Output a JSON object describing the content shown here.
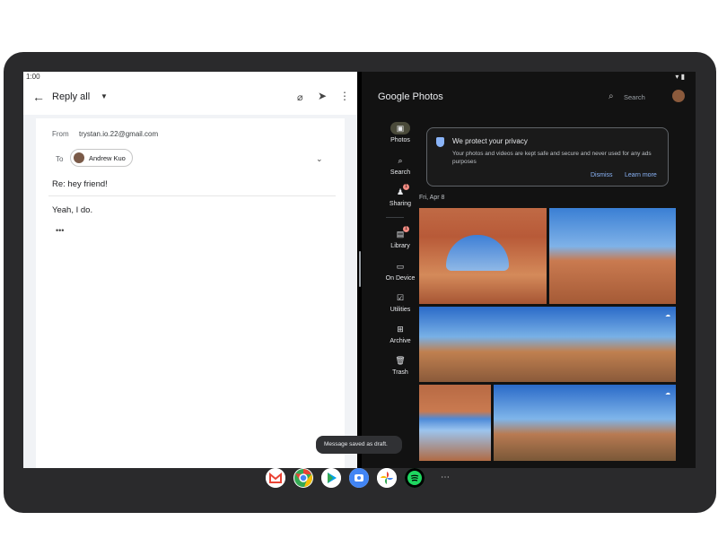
{
  "status_bar": {
    "time": "1:00",
    "icons": "▾ ▮"
  },
  "gmail": {
    "back_icon": "arrow-left-icon",
    "title": "Reply all",
    "from_label": "From",
    "from_value": "trystan.io.22@gmail.com",
    "to_label": "To",
    "recipient": "Andrew Kuo",
    "subject": "Re: hey friend!",
    "body": "Yeah, I do.",
    "quoted_toggle": "•••"
  },
  "photos": {
    "logo": "Google Photos",
    "search_placeholder": "Search",
    "nav": [
      {
        "label": "Photos",
        "icon": "photo-icon",
        "active": true
      },
      {
        "label": "Search",
        "icon": "search-icon",
        "active": false
      },
      {
        "label": "Sharing",
        "icon": "people-icon",
        "badge": "1"
      },
      {
        "label": "Library",
        "icon": "library-icon",
        "badge": "1"
      },
      {
        "label": "On Device",
        "icon": "folder-icon"
      },
      {
        "label": "Utilities",
        "icon": "utilities-icon"
      },
      {
        "label": "Archive",
        "icon": "archive-icon"
      },
      {
        "label": "Trash",
        "icon": "trash-icon"
      }
    ],
    "privacy_card": {
      "title": "We protect your privacy",
      "body": "Your photos and videos are kept safe and secure and never used for any ads purposes",
      "dismiss": "Dismiss",
      "learn_more": "Learn more"
    },
    "date_header": "Fri, Apr 8"
  },
  "toast": "Message saved as draft.",
  "dock": [
    "gmail-icon",
    "chrome-icon",
    "play-store-icon",
    "camera-icon",
    "photos-icon",
    "spotify-icon",
    "app-drawer-icon"
  ],
  "colors": {
    "photos_bg": "#121212",
    "link": "#8ab4f8",
    "gmail_bg": "#f1f3f6"
  }
}
